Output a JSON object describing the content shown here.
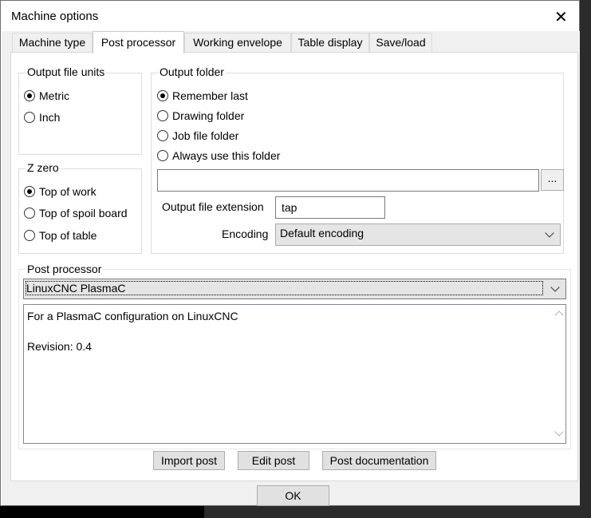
{
  "window": {
    "title": "Machine options",
    "close_glyph": "✕"
  },
  "tabs": [
    {
      "label": "Machine type"
    },
    {
      "label": "Post processor"
    },
    {
      "label": "Working envelope"
    },
    {
      "label": "Table display"
    },
    {
      "label": "Save/load"
    }
  ],
  "active_tab": "Post processor",
  "output_units": {
    "legend": "Output file units",
    "options": [
      {
        "label": "Metric",
        "checked": true
      },
      {
        "label": "Inch",
        "checked": false
      }
    ]
  },
  "z_zero": {
    "legend": "Z zero",
    "options": [
      {
        "label": "Top of work",
        "checked": true
      },
      {
        "label": "Top of spoil board",
        "checked": false
      },
      {
        "label": "Top of table",
        "checked": false
      }
    ]
  },
  "output_folder": {
    "legend": "Output folder",
    "options": [
      {
        "label": "Remember last",
        "checked": true
      },
      {
        "label": "Drawing folder",
        "checked": false
      },
      {
        "label": "Job file folder",
        "checked": false
      },
      {
        "label": "Always use this folder",
        "checked": false
      }
    ],
    "path_value": "",
    "browse_label": "...",
    "extension_label": "Output file extension",
    "extension_value": "tap",
    "encoding_label": "Encoding",
    "encoding_value": "Default encoding"
  },
  "post_processor": {
    "legend": "Post processor",
    "selected": "LinuxCNC PlasmaC",
    "description_line1": "For a PlasmaC configuration on LinuxCNC",
    "description_line2": "Revision: 0.4"
  },
  "buttons": {
    "import": "Import post",
    "edit": "Edit post",
    "docs": "Post documentation",
    "ok": "OK"
  }
}
